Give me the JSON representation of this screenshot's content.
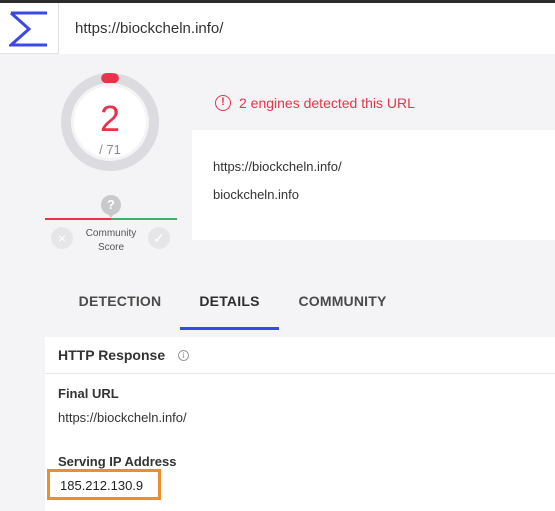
{
  "search": {
    "url_value": "https://biockcheln.info/"
  },
  "score": {
    "detected": "2",
    "total": "/ 71",
    "ratio": 0.028
  },
  "community_score": {
    "label_line1": "Community",
    "label_line2": "Score",
    "question": "?",
    "down_symbol": "×",
    "up_symbol": "✓"
  },
  "detection_summary": {
    "warning_symbol": "!",
    "text": "2 engines detected this URL",
    "url": "https://biockcheln.info/",
    "domain": "biockcheln.info"
  },
  "tabs": [
    {
      "label": "DETECTION"
    },
    {
      "label": "DETAILS"
    },
    {
      "label": "COMMUNITY"
    }
  ],
  "details": {
    "section_title": "HTTP Response",
    "info_symbol": "i",
    "final_url_label": "Final URL",
    "final_url_value": "https://biockcheln.info/",
    "ip_label": "Serving IP Address",
    "ip_value": "185.212.130.9"
  },
  "colors": {
    "accent": "#3b48e8",
    "danger": "#e8334a",
    "success": "#3fae68",
    "highlight": "#f28b2b"
  }
}
